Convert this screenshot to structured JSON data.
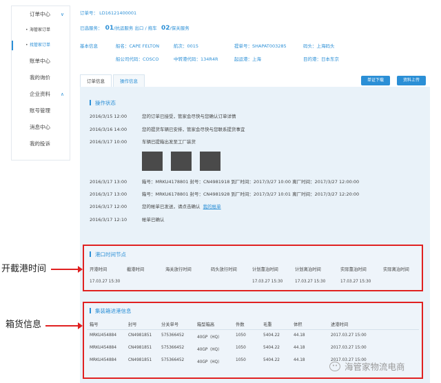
{
  "sidebar": {
    "order_center": "订单中心",
    "sub_items": [
      "海管家订单",
      "找管家订单"
    ],
    "items": [
      "账单中心",
      "我的询价"
    ],
    "enterprise": "企业资料",
    "items2": [
      "账号管理",
      "消息中心",
      "我的投诉"
    ]
  },
  "header": {
    "order_no_label": "订单号：",
    "order_no": "LD16121400001",
    "services_label": "已选服务：",
    "service1_num": "01",
    "service1": "/抗运服务 出口 / 拖车",
    "service2_num": "02",
    "service2": "/保关服务",
    "basic_label": "基本信息",
    "ship_name": "船名：CAPE FELTON",
    "voyage": "航次：0015",
    "bl_no": "提单号：SHAPAT003285",
    "terminal": "码头：上海码头",
    "carrier_code": "船公司代码：COSCO",
    "transship_code": "中转港代码：134R4R",
    "port_loading": "起运港：上海",
    "destination": "目的港：日本东京"
  },
  "tabs": [
    "订单信息",
    "操作信息"
  ],
  "buttons": {
    "download": "单证下载",
    "upload": "资料上传"
  },
  "ops": {
    "title": "操作状态",
    "log": [
      {
        "time": "2016/3/15 12:00",
        "text": "您的订单已接受，管家会尽快与您确认订单详情"
      },
      {
        "time": "2016/3/16 14:00",
        "text": "您的提货车辆已安排，管家会尽快与您联系提货事宜"
      },
      {
        "time": "2016/3/17 10:00",
        "text": "车辆已提箱出发至工厂装货"
      },
      {
        "time": "2016/3/17 13:00",
        "text": "箱号：MRKU4178801  封号：CN4981918  到厂时间：2017/3/27  10:00  离厂时间：2017/3/27 12:00:00"
      },
      {
        "time": "2016/3/17 13:00",
        "text": "箱号：MRKU6178801  封号：CN4981928  到厂时间：2017/3/27  10:01  离厂时间：2017/3/27 12:20:00"
      },
      {
        "time": "2016/3/17 12:00",
        "text": "您的帐单已发送，请点击确认",
        "link": "我的帐单"
      },
      {
        "time": "2016/3/17 12:10",
        "text": "帐单已确认"
      }
    ]
  },
  "port": {
    "title": "港口时间节点",
    "headers": [
      "开港时间",
      "截港时间",
      "海关放行时间",
      "码头放行时间",
      "计划靠泊时间",
      "计划离泊时间",
      "实际靠泊时间",
      "实际离泊时间"
    ],
    "values": [
      "17.03.27 15:30",
      "",
      "",
      "",
      "17.03.27 15:30",
      "17.03.27 15:30",
      "17.03.27 15:30",
      ""
    ]
  },
  "containers": {
    "title": "集装箱进港信息",
    "headers": [
      "箱号",
      "封号",
      "分关单号",
      "箱型箱高",
      "件数",
      "毛重",
      "体积",
      "进港时间"
    ],
    "rows": [
      [
        "MRKU454884",
        "CN4981851",
        "575366452",
        "40GP（HQ）",
        "1050",
        "5404.22",
        "44.18",
        "2017.03.27 15:00"
      ],
      [
        "MRKU454884",
        "CN4981851",
        "575366452",
        "40GP（HQ）",
        "1050",
        "5404.22",
        "44.18",
        "2017.03.27 15:00"
      ],
      [
        "MRKU454884",
        "CN4981851",
        "575366452",
        "40GP（HQ）",
        "1050",
        "5404.22",
        "44.18",
        "2017.03.27 15:00"
      ]
    ]
  },
  "annotations": {
    "port_time": "开截港时间",
    "cargo": "箱货信息"
  },
  "watermark": "海管家物流电商"
}
